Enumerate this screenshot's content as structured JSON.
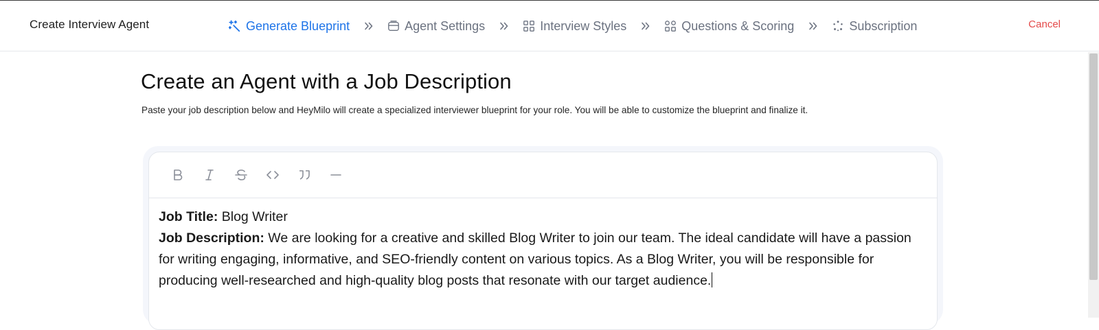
{
  "header": {
    "title": "Create Interview Agent",
    "steps": [
      {
        "label": "Generate Blueprint",
        "icon": "magic-wand-icon",
        "active": true
      },
      {
        "label": "Agent Settings",
        "icon": "settings-card-icon",
        "active": false
      },
      {
        "label": "Interview Styles",
        "icon": "grid-icon",
        "active": false
      },
      {
        "label": "Questions & Scoring",
        "icon": "grid-icon",
        "active": false
      },
      {
        "label": "Subscription",
        "icon": "refresh-icon",
        "active": false
      }
    ],
    "cancel_label": "Cancel"
  },
  "main": {
    "title": "Create an Agent with a Job Description",
    "subtitle": "Paste your job description below and HeyMilo will create a specialized interviewer blueprint for your role. You will be able to customize the blueprint and finalize it."
  },
  "editor": {
    "toolbar": [
      {
        "name": "bold-icon"
      },
      {
        "name": "italic-icon"
      },
      {
        "name": "strikethrough-icon"
      },
      {
        "name": "code-icon"
      },
      {
        "name": "quote-icon"
      },
      {
        "name": "horizontal-rule-icon"
      }
    ],
    "job_title_label": "Job Title:",
    "job_title_value": " Blog Writer",
    "job_description_label": "Job Description:",
    "job_description_value": " We are looking for a creative and skilled Blog Writer to join our team. The ideal candidate will have a passion for writing engaging, informative, and SEO-friendly content on various topics. As a Blog Writer, you will be responsible for producing well-researched and high-quality blog posts that resonate with our target audience."
  },
  "colors": {
    "accent": "#1e74e8",
    "cancel": "#e44949",
    "muted": "#6b7280"
  }
}
